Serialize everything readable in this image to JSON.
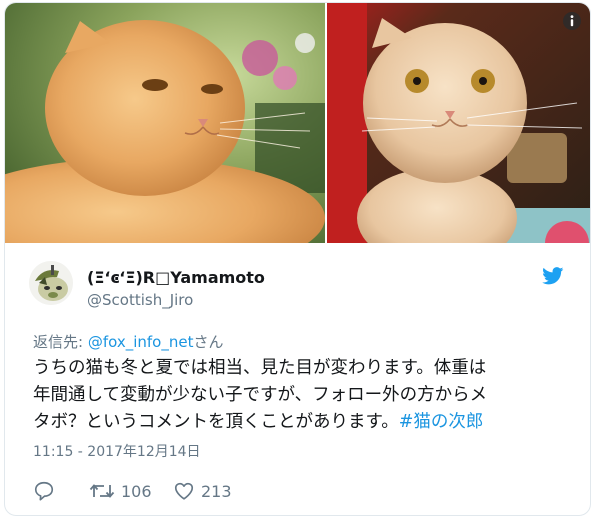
{
  "tweet": {
    "author_name": "(ΞʻͼʻΞ)R□Yamamoto",
    "author_handle": "@Scottish_Jiro",
    "reply_prefix": "返信先:",
    "reply_to": "@fox_info_net",
    "reply_suffix": "さん",
    "text_line1": "うちの猫も冬と夏では相当、見た目が変わります。体重は",
    "text_line2": "年間通して変動が少ない子ですが、フォロー外の方からメ",
    "text_line3_plain": "タボ？というコメントを頂くことがあります。",
    "hashtag": "#猫の次郎",
    "timestamp": "11:15 - 2017年12月14日",
    "retweet_count": "106",
    "like_count": "213"
  },
  "icons": {
    "info": "info-icon",
    "brand": "twitter-bird-icon",
    "reply": "reply-icon",
    "retweet": "retweet-icon",
    "like": "heart-icon"
  },
  "colors": {
    "link": "#1b95e0",
    "muted": "#657786",
    "text": "#14171a",
    "brand": "#1da1f2"
  }
}
